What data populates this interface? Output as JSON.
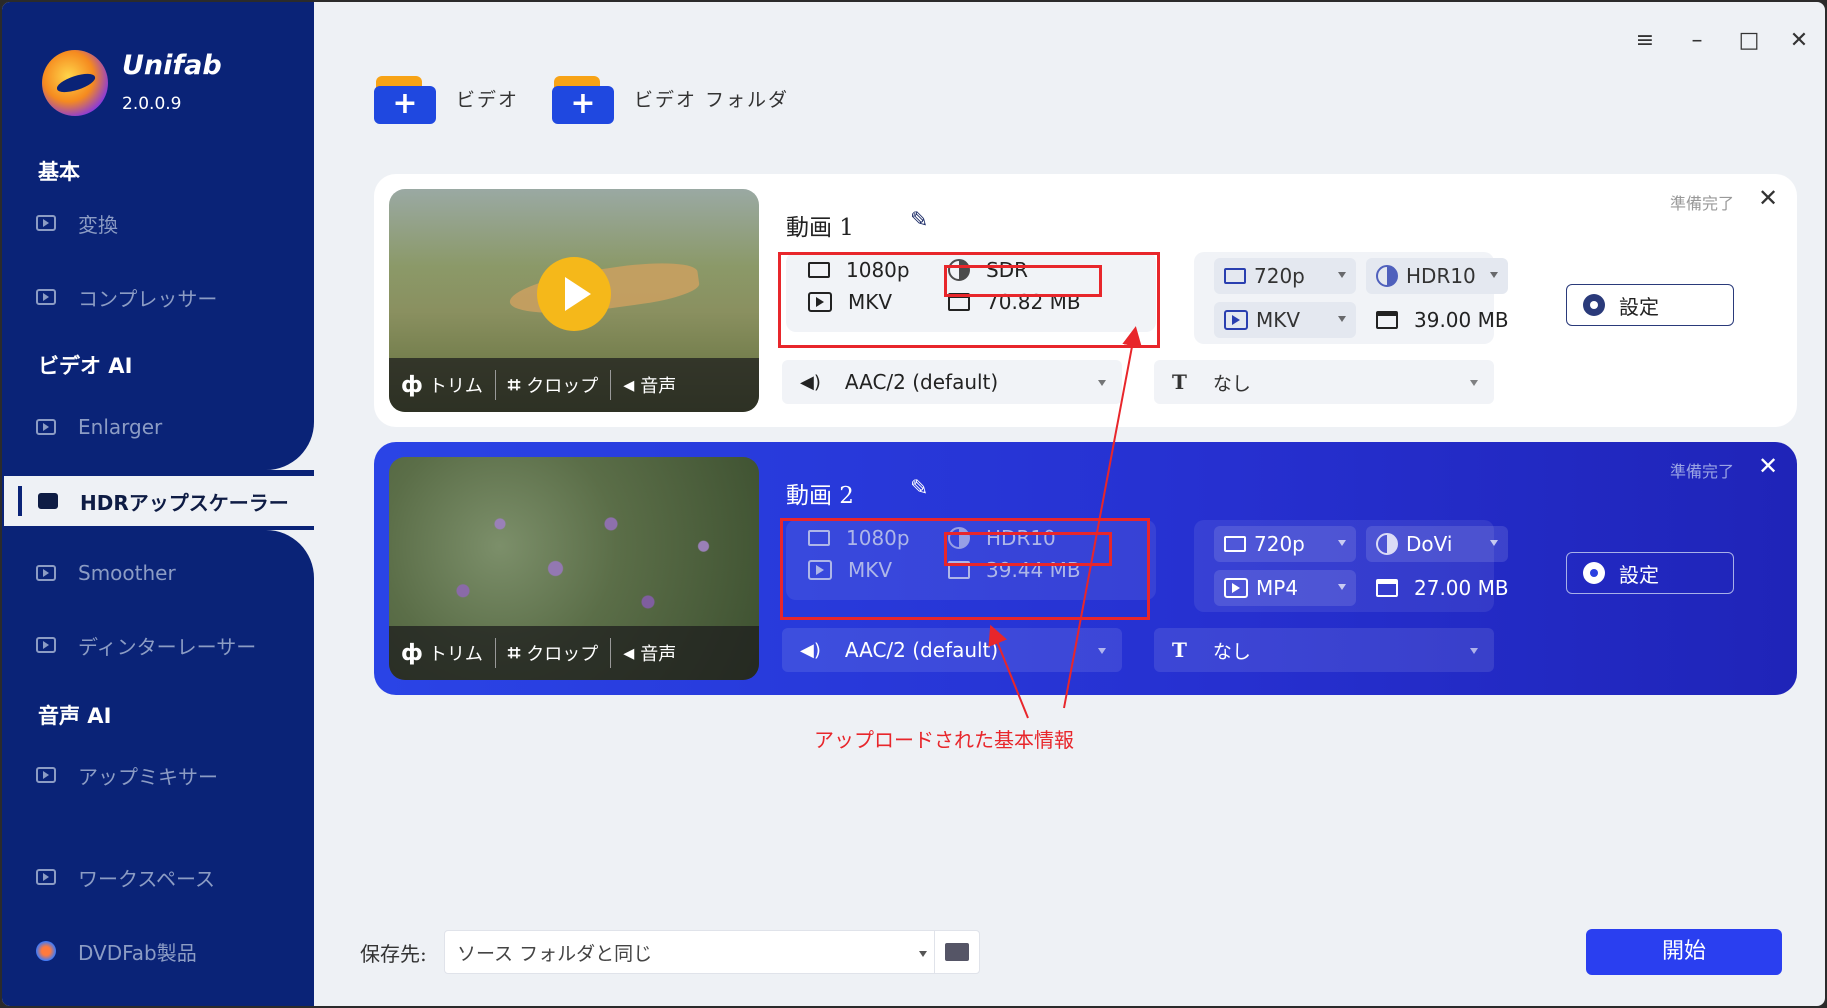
{
  "app": {
    "brand": "Unifab",
    "version": "2.0.0.9"
  },
  "sidebar": {
    "sections": [
      "基本",
      "ビデオ AI",
      "音声 AI"
    ],
    "items": [
      {
        "label": "変換"
      },
      {
        "label": "コンプレッサー"
      },
      {
        "label": "Enlarger"
      },
      {
        "label": "HDRアップスケーラー"
      },
      {
        "label": "Smoother"
      },
      {
        "label": "ディンターレーサー"
      },
      {
        "label": "アップミキサー"
      },
      {
        "label": "ワークスペース"
      },
      {
        "label": "DVDFab製品"
      }
    ]
  },
  "toolbar": {
    "add_video": "ビデオ",
    "add_folder": "ビデオ フォルダ"
  },
  "videos": [
    {
      "title": "動画 1",
      "status": "準備完了",
      "thumb_actions": [
        "トリム",
        "クロップ",
        "音声"
      ],
      "source": {
        "resolution": "1080p",
        "range": "SDR",
        "container": "MKV",
        "size": "70.82 MB"
      },
      "target": {
        "resolution": "720p",
        "range": "HDR10",
        "container": "MKV",
        "size": "39.00 MB"
      },
      "settings_label": "設定",
      "audio": "AAC/2 (default)",
      "subtitle": "なし"
    },
    {
      "title": "動画 2",
      "status": "準備完了",
      "thumb_actions": [
        "トリム",
        "クロップ",
        "音声"
      ],
      "source": {
        "resolution": "1080p",
        "range": "HDR10",
        "container": "MKV",
        "size": "39.44 MB"
      },
      "target": {
        "resolution": "720p",
        "range": "DoVi",
        "container": "MP4",
        "size": "27.00 MB"
      },
      "settings_label": "設定",
      "audio": "AAC/2 (default)",
      "subtitle": "なし"
    }
  ],
  "annotation": "アップロードされた基本情報",
  "footer": {
    "save_label": "保存先:",
    "save_value": "ソース フォルダと同じ",
    "start_label": "開始"
  },
  "colors": {
    "sidebar": "#0a2377",
    "accent": "#2a3ff0",
    "highlight": "#e8262b"
  }
}
